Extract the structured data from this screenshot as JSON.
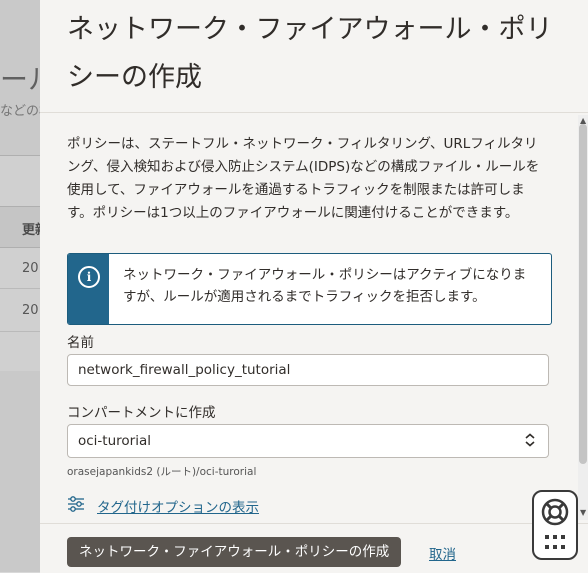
{
  "background": {
    "title_fragment": "ール",
    "subtitle_fragment": "などの構",
    "column_header_fragment": "更新",
    "rows": [
      "20",
      "20"
    ]
  },
  "panel": {
    "title": "ネットワーク・ファイアウォール・ポリシーの作成",
    "description": "ポリシーは、ステートフル・ネットワーク・フィルタリング、URLフィルタリング、侵入検知および侵入防止システム(IDPS)などの構成ファイル・ルールを使用して、ファイアウォールを通過するトラフィックを制限または許可します。ポリシーは1つ以上のファイアウォールに関連付けることができます。",
    "alert": {
      "icon": "info-icon",
      "text": "ネットワーク・ファイアウォール・ポリシーはアクティブになりますが、ルールが適用されるまでトラフィックを拒否します。"
    },
    "name_field": {
      "label": "名前",
      "value": "network_firewall_policy_tutorial"
    },
    "compartment_field": {
      "label": "コンパートメントに作成",
      "value": "oci-turorial",
      "path": "orasejapankids2 (ルート)/oci-turorial"
    },
    "tag_options_link": "タグ付けオプションの表示"
  },
  "footer": {
    "create_button": "ネットワーク・ファイアウォール・ポリシーの作成",
    "cancel_link": "取消"
  },
  "help_widget": {
    "icons": [
      "lifebuoy-icon",
      "grid-icon"
    ]
  }
}
